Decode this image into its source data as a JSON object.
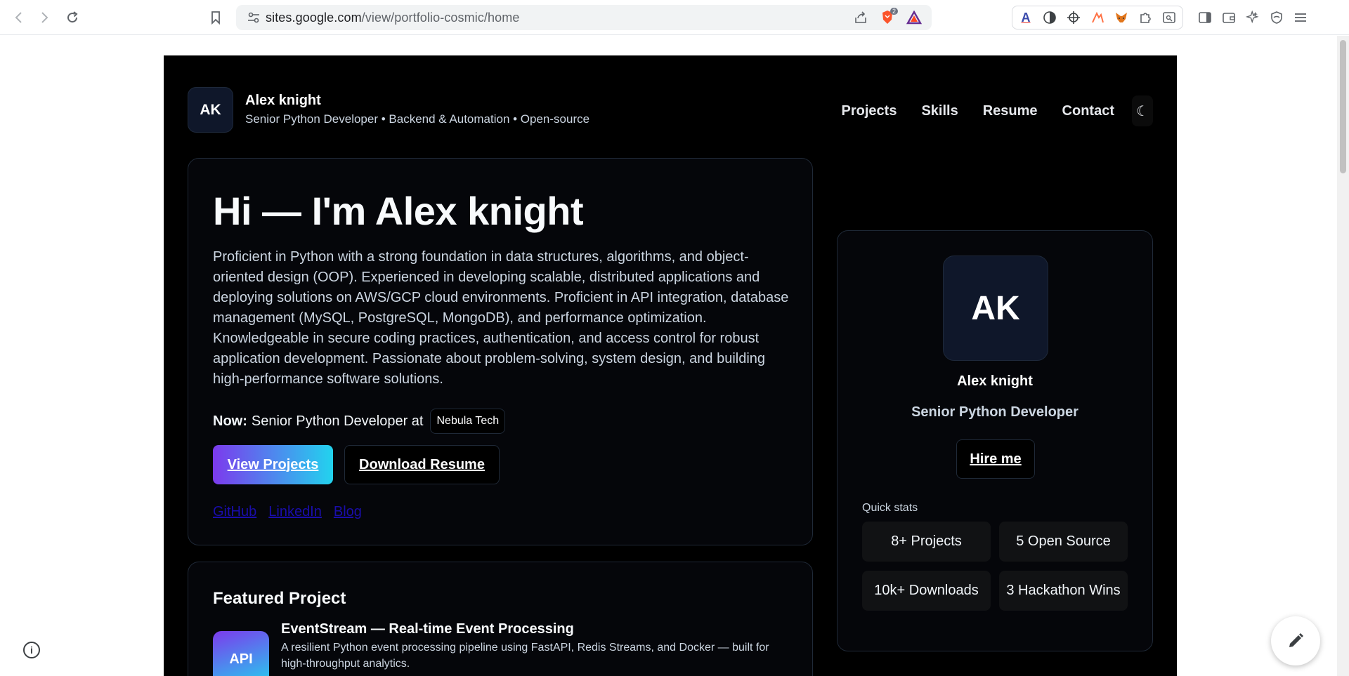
{
  "browser": {
    "url_host": "sites.google.com",
    "url_path": "/view/portfolio-cosmic/home",
    "brave_badge": "2"
  },
  "site": {
    "logo_initials": "AK",
    "name": "Alex knight",
    "tagline": "Senior Python Developer • Backend & Automation • Open-source",
    "nav": [
      "Projects",
      "Skills",
      "Resume",
      "Contact"
    ],
    "theme_toggle": "☾"
  },
  "hero": {
    "title": "Hi — I'm Alex knight",
    "bio": "Proficient in Python with a strong foundation in data structures, algorithms, and object-oriented design (OOP). Experienced in developing scalable, distributed applications and deploying solutions on AWS/GCP cloud environments. Proficient in API integration, database management (MySQL, PostgreSQL, MongoDB), and performance optimization. Knowledgeable in secure coding practices, authentication, and access control for robust application development. Passionate about problem-solving, system design, and building high-performance software solutions.",
    "now_label": "Now:",
    "now_text": "Senior Python Developer at",
    "company": "Nebula Tech",
    "primary_button": "View Projects",
    "secondary_button": "Download Resume",
    "links": [
      "GitHub",
      "LinkedIn",
      "Blog"
    ]
  },
  "featured": {
    "heading": "Featured Project",
    "icon_label": "API",
    "title": "EventStream — Real-time Event Processing",
    "description": "A resilient Python event processing pipeline using FastAPI, Redis Streams, and Docker — built for high-throughput analytics."
  },
  "profile": {
    "initials": "AK",
    "name": "Alex knight",
    "role": "Senior Python Developer",
    "hire_button": "Hire me",
    "quick_stats_label": "Quick stats",
    "stats": [
      "8+ Projects",
      "5 Open Source",
      "10k+ Downloads",
      "3 Hackathon Wins"
    ]
  },
  "colors": {
    "site_background": "#000000",
    "accent_gradient_start": "#7c3aed",
    "accent_gradient_end": "#22d3ee",
    "link": "#1a0dab"
  }
}
